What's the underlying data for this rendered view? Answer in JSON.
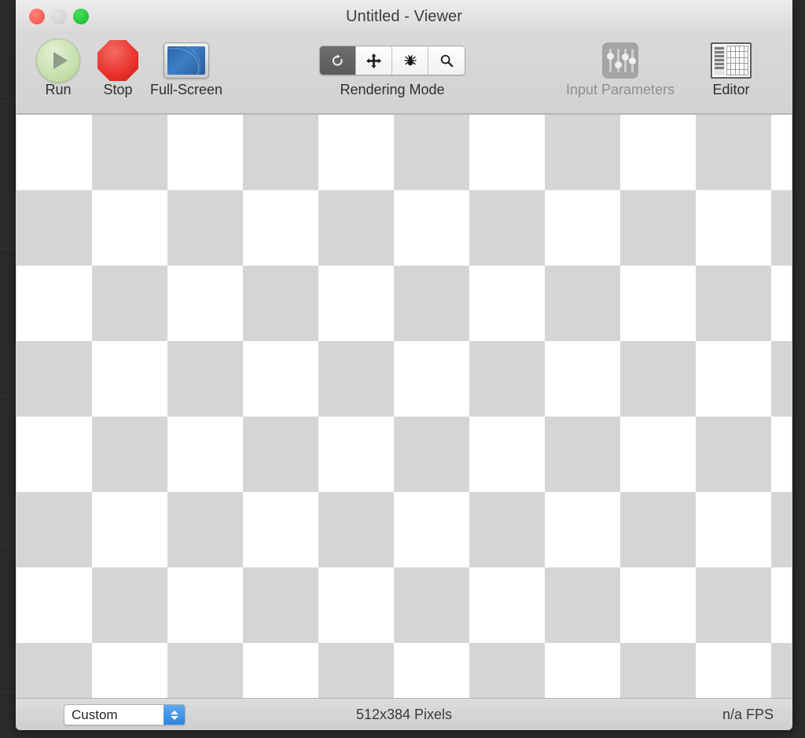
{
  "window": {
    "title": "Untitled - Viewer",
    "traffic_lights": [
      {
        "name": "close",
        "color": "#fc5d52"
      },
      {
        "name": "minimize",
        "color": "#d4d4d4"
      },
      {
        "name": "zoom",
        "color": "#1fc63a"
      }
    ]
  },
  "toolbar": {
    "items": [
      {
        "label": "Run",
        "icon": "play-circle-icon",
        "enabled": true
      },
      {
        "label": "Stop",
        "icon": "stop-octagon-icon",
        "enabled": true
      },
      {
        "label": "Full-Screen",
        "icon": "monitor-icon",
        "enabled": true
      },
      {
        "label": "Rendering Mode",
        "icon": "segmented-control",
        "enabled": true
      },
      {
        "label": "Input Parameters",
        "icon": "sliders-icon",
        "enabled": false
      },
      {
        "label": "Editor",
        "icon": "table-editor-icon",
        "enabled": true
      }
    ],
    "rendering_mode": {
      "label": "Rendering Mode",
      "segments": [
        {
          "name": "refresh-icon",
          "selected": true
        },
        {
          "name": "move-arrows-icon",
          "selected": false
        },
        {
          "name": "bug-icon",
          "selected": false
        },
        {
          "name": "magnifier-icon",
          "selected": false
        }
      ]
    },
    "input_parameters_label": "Input Parameters",
    "editor_label": "Editor",
    "run_label": "Run",
    "stop_label": "Stop",
    "fullscreen_label": "Full-Screen"
  },
  "canvas": {
    "pattern": "checkerboard",
    "square_size": 96,
    "colors": {
      "light": "#ffffff",
      "dark": "#d5d5d5"
    }
  },
  "statusbar": {
    "size_preset": "Custom",
    "resolution": "512x384 Pixels",
    "fps": "n/a FPS"
  }
}
